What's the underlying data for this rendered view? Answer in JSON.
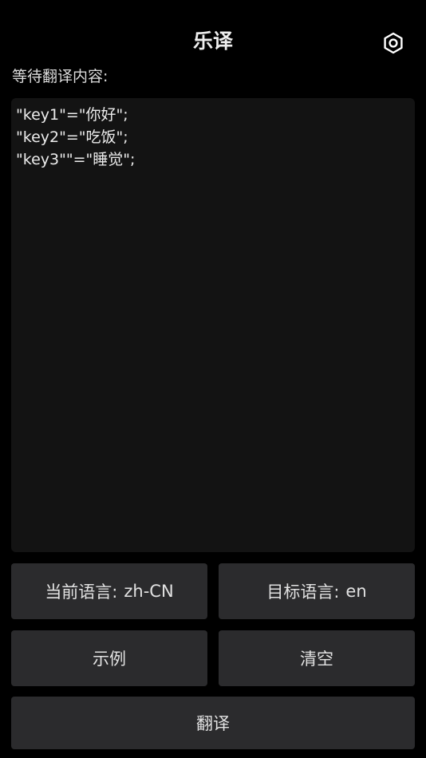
{
  "header": {
    "title": "乐译",
    "settings_icon": "gear-icon"
  },
  "input": {
    "label": "等待翻译内容:",
    "value": "\"key1\"=\"你好\";\n\"key2\"=\"吃饭\";\n\"key3\"\"=\"睡觉\";"
  },
  "language": {
    "current_label": "当前语言:",
    "current_value": "zh-CN",
    "target_label": "目标语言:",
    "target_value": "en"
  },
  "actions": {
    "example_label": "示例",
    "clear_label": "清空",
    "translate_label": "翻译"
  },
  "colors": {
    "background": "#000000",
    "editor_bg": "#131313",
    "button_bg": "#2b2b2d",
    "text": "#e6e6e6"
  }
}
